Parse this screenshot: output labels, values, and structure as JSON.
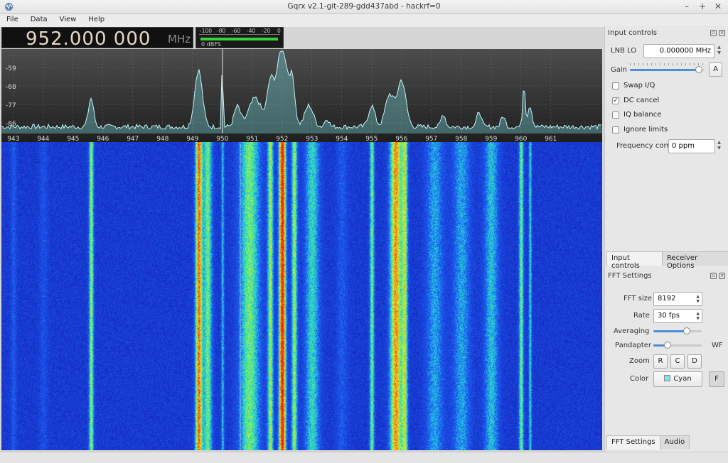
{
  "window": {
    "title": "Gqrx v2.1-git-289-gdd437abd - hackrf=0",
    "controls": [
      "–",
      "+",
      "✕"
    ]
  },
  "menu": [
    "File",
    "Data",
    "View",
    "Help"
  ],
  "frequency": {
    "digits": "952.000 000",
    "unit": "MHz"
  },
  "meter": {
    "scale": [
      "-100",
      "-80",
      "-60",
      "-40",
      "-20",
      "0"
    ],
    "label": "0 dBFS",
    "level_fraction": 0.97
  },
  "spectrum": {
    "db_labels": [
      "-59",
      "-68",
      "-77",
      "-86"
    ],
    "freq_labels": [
      "943",
      "944",
      "945",
      "946",
      "947",
      "948",
      "949",
      "950",
      "951",
      "952",
      "953",
      "954",
      "955",
      "956",
      "957",
      "958",
      "959",
      "960",
      "961"
    ]
  },
  "input_controls": {
    "title": "Input controls",
    "lnb_label": "LNB LO",
    "lnb_value": "0.000000 MHz",
    "gain_label": "Gain",
    "gain_level": 0.98,
    "gain_auto": "A",
    "checkboxes": [
      {
        "label": "Swap I/Q",
        "checked": false
      },
      {
        "label": "DC cancel",
        "checked": true
      },
      {
        "label": "IQ balance",
        "checked": false
      },
      {
        "label": "Ignore limits",
        "checked": false
      }
    ],
    "freq_corr_label": "Frequency corr.",
    "freq_corr_value": "0 ppm"
  },
  "top_tabs": [
    "Input controls",
    "Receiver Options"
  ],
  "fft_settings": {
    "title": "FFT Settings",
    "fft_size_label": "FFT size",
    "fft_size_value": "8192",
    "rate_label": "Rate",
    "rate_value": "30 fps",
    "averaging_label": "Averaging",
    "averaging_level": 0.72,
    "pandapter_label": "Pandapter",
    "pandapter_level": 0.25,
    "wf_label": "WF",
    "zoom_label": "Zoom",
    "zoom_buttons": [
      "R",
      "C",
      "D"
    ],
    "color_label": "Color",
    "color_value": "Cyan",
    "color_swatch": "#7fe3e8",
    "fill_button": "F"
  },
  "bottom_tabs": [
    "FFT Settings",
    "Audio"
  ]
}
